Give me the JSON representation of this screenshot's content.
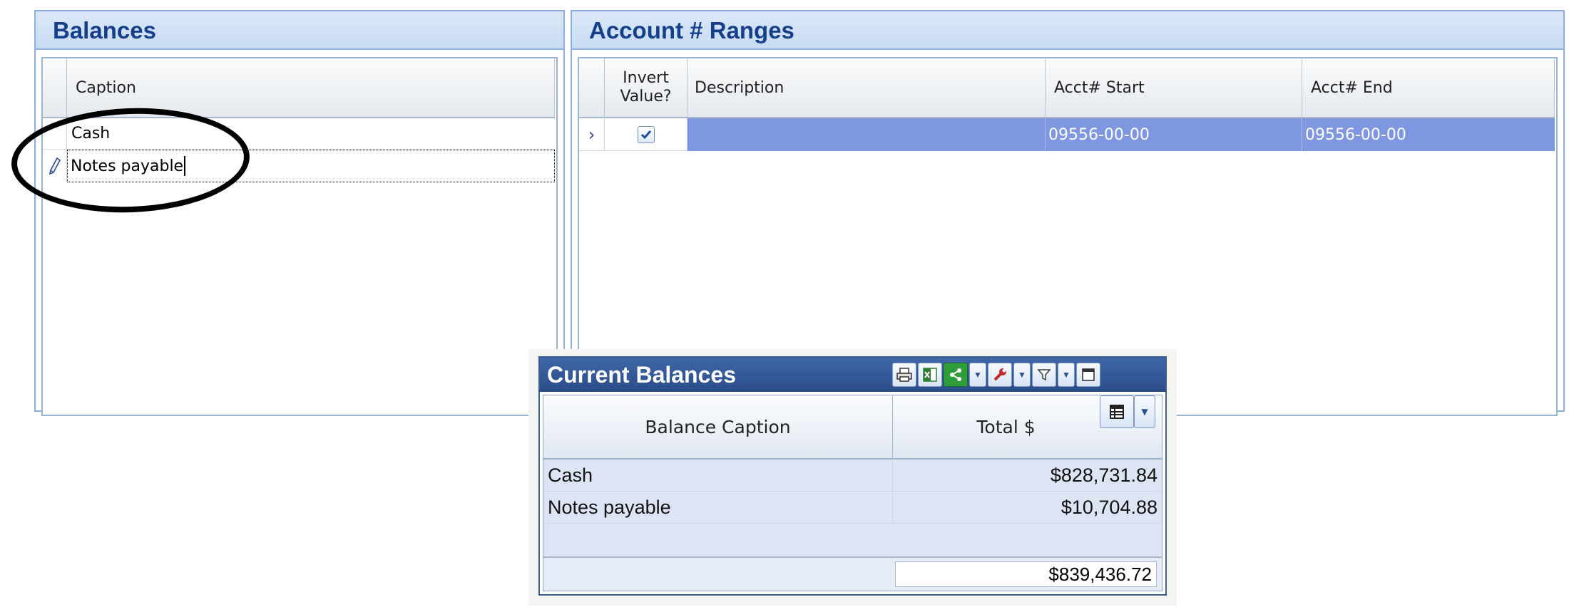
{
  "balances": {
    "title": "Balances",
    "header": {
      "caption": "Caption"
    },
    "rows": [
      {
        "caption": "Cash"
      },
      {
        "caption": "Notes payable"
      }
    ]
  },
  "ranges": {
    "title": "Account # Ranges",
    "headers": {
      "invert": "Invert Value?",
      "description": "Description",
      "start": "Acct# Start",
      "end": "Acct# End"
    },
    "rows": [
      {
        "invert": true,
        "description": "",
        "start": "09556-00-00",
        "end": "09556-00-00"
      }
    ]
  },
  "current_balances": {
    "title": "Current Balances",
    "headers": {
      "caption": "Balance Caption",
      "total": "Total $"
    },
    "rows": [
      {
        "caption": "Cash",
        "total": "$828,731.84"
      },
      {
        "caption": "Notes payable",
        "total": "$10,704.88"
      }
    ],
    "grand_total": "$839,436.72",
    "toolbar": [
      "print-icon",
      "excel-export-icon",
      "share-icon",
      "wrench-icon",
      "filter-icon",
      "maximize-icon",
      "column-chooser-icon"
    ]
  },
  "colors": {
    "panel_title": "#153f8a",
    "selected_row": "#7e97e0",
    "widget_title": "#2a4c88"
  }
}
